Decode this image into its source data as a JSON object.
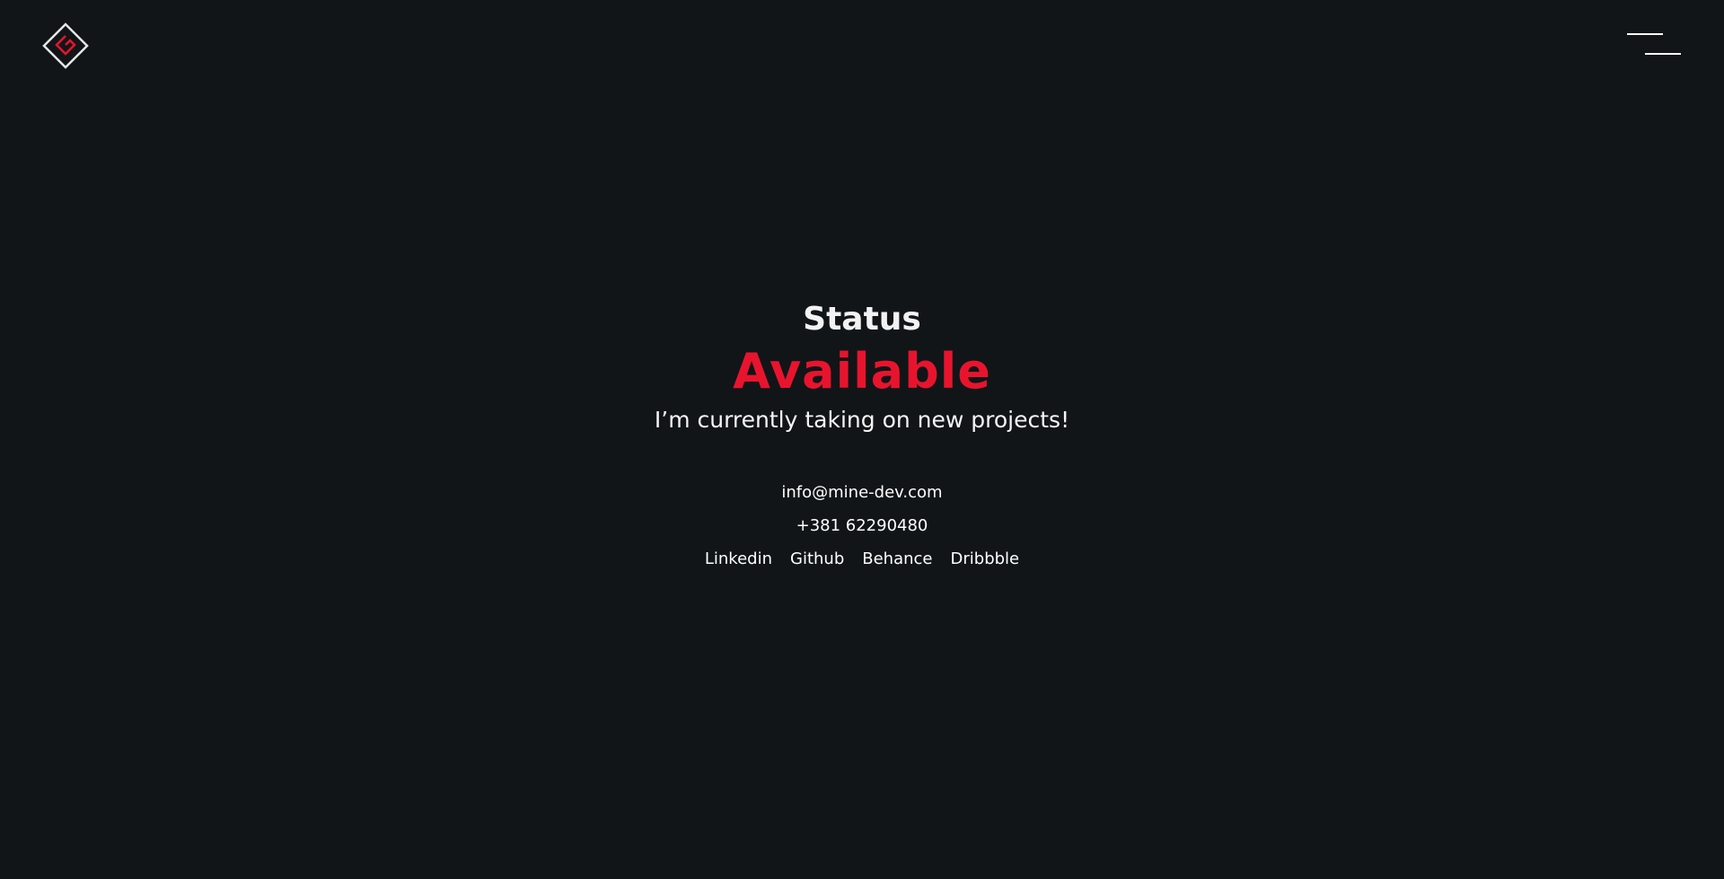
{
  "colors": {
    "background": "#111518",
    "accent": "#e8142e",
    "text": "#ffffff"
  },
  "header": {
    "logo_icon": "diamond-logo-icon",
    "menu_icon": "hamburger-menu-icon"
  },
  "status": {
    "label": "Status",
    "value": "Available",
    "message": "I’m currently taking on new projects!"
  },
  "contact": {
    "email": "info@mine-dev.com",
    "phone": "+381 62290480"
  },
  "socials": [
    {
      "label": "Linkedin"
    },
    {
      "label": "Github"
    },
    {
      "label": "Behance"
    },
    {
      "label": "Dribbble"
    }
  ]
}
